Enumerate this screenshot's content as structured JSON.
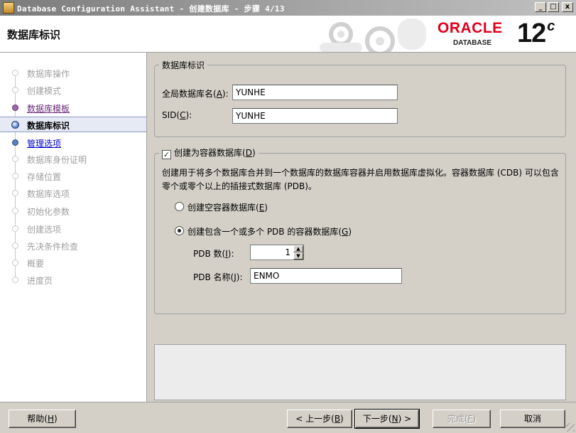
{
  "window": {
    "title": "Database Configuration Assistant - 创建数据库 - 步骤 4/13",
    "minimize": "_",
    "maximize": "□",
    "close": "x"
  },
  "header": {
    "page_title": "数据库标识",
    "logo": {
      "oracle": "ORACLE",
      "database": "DATABASE",
      "version": "12",
      "version_suffix": "c"
    }
  },
  "sidebar": {
    "items": [
      {
        "label": "数据库操作",
        "state": "inactive"
      },
      {
        "label": "创建模式",
        "state": "inactive"
      },
      {
        "label": "数据库模板",
        "state": "visited"
      },
      {
        "label": "数据库标识",
        "state": "current"
      },
      {
        "label": "管理选项",
        "state": "link"
      },
      {
        "label": "数据库身份证明",
        "state": "inactive"
      },
      {
        "label": "存储位置",
        "state": "inactive"
      },
      {
        "label": "数据库选项",
        "state": "inactive"
      },
      {
        "label": "初始化参数",
        "state": "inactive"
      },
      {
        "label": "创建选项",
        "state": "inactive"
      },
      {
        "label": "先决条件检查",
        "state": "inactive"
      },
      {
        "label": "概要",
        "state": "inactive"
      },
      {
        "label": "进度页",
        "state": "inactive"
      }
    ]
  },
  "identity": {
    "legend": "数据库标识",
    "global_name_label": "全局数据库名",
    "global_name_key": "A",
    "global_name_value": "YUNHE",
    "sid_label": "SID",
    "sid_key": "C",
    "sid_value": "YUNHE"
  },
  "container": {
    "checkbox_label": "创建为容器数据库",
    "checkbox_key": "D",
    "checked": true,
    "check_mark": "✓",
    "description": "创建用于将多个数据库合并到一个数据库的数据库容器并启用数据库虚拟化。容器数据库 (CDB) 可以包含零个或零个以上的插接式数据库 (PDB)。",
    "empty_option": "创建空容器数据库",
    "empty_key": "E",
    "pdb_option": "创建包含一个或多个 PDB 的容器数据库",
    "pdb_key": "G",
    "selected_option": "pdb",
    "pdb_count_label": "PDB 数",
    "pdb_count_key": "I",
    "pdb_count_value": "1",
    "pdb_name_label": "PDB 名称",
    "pdb_name_key": "J",
    "pdb_name_value": "ENMO"
  },
  "footer": {
    "help": "帮助",
    "help_key": "H",
    "back": "< 上一步",
    "back_key": "B",
    "next": "下一步",
    "next_key": "N",
    "next_suffix": " >",
    "finish": "完成",
    "finish_key": "F",
    "cancel": "取消"
  }
}
